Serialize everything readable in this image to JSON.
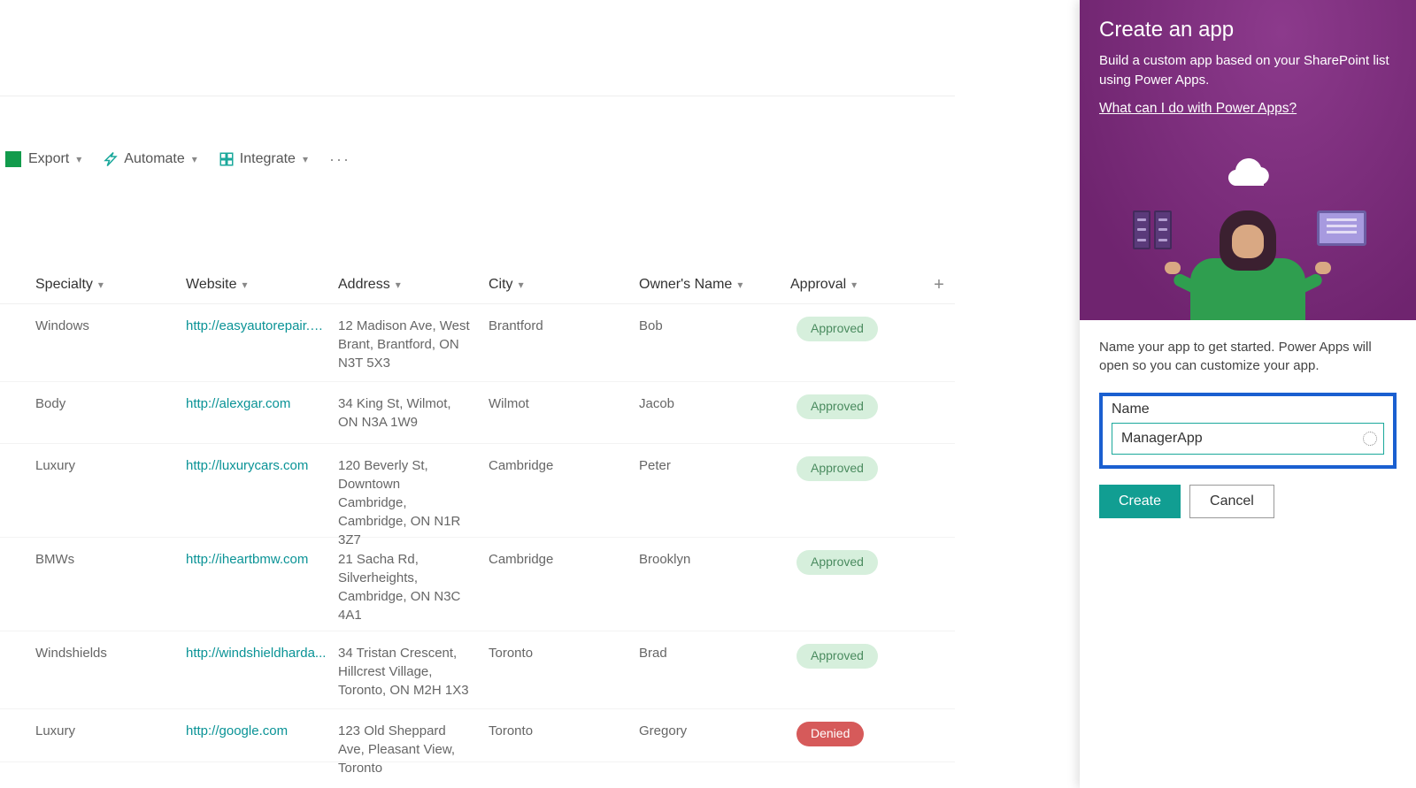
{
  "toolbar": {
    "export": "Export",
    "automate": "Automate",
    "integrate": "Integrate"
  },
  "columns": {
    "specialty": "Specialty",
    "website": "Website",
    "address": "Address",
    "city": "City",
    "owner": "Owner's Name",
    "approval": "Approval"
  },
  "rows": [
    {
      "specialty": "Windows",
      "website": "http://easyautorepair.c...",
      "address": "12 Madison Ave, West Brant, Brantford, ON N3T 5X3",
      "city": "Brantford",
      "owner": "Bob",
      "approval": "Approved"
    },
    {
      "specialty": "Body",
      "website": "http://alexgar.com",
      "address": "34 King St, Wilmot, ON N3A 1W9",
      "city": "Wilmot",
      "owner": "Jacob",
      "approval": "Approved"
    },
    {
      "specialty": "Luxury",
      "website": "http://luxurycars.com",
      "address": "120 Beverly St, Downtown Cambridge, Cambridge, ON N1R 3Z7",
      "city": "Cambridge",
      "owner": "Peter",
      "approval": "Approved"
    },
    {
      "specialty": "BMWs",
      "website": "http://iheartbmw.com",
      "address": "21 Sacha Rd, Silverheights, Cambridge, ON N3C 4A1",
      "city": "Cambridge",
      "owner": "Brooklyn",
      "approval": "Approved"
    },
    {
      "specialty": "Windshields",
      "website": "http://windshieldharda...",
      "address": "34 Tristan Crescent, Hillcrest Village, Toronto, ON M2H 1X3",
      "city": "Toronto",
      "owner": "Brad",
      "approval": "Approved"
    },
    {
      "specialty": "Luxury",
      "website": "http://google.com",
      "address": "123 Old Sheppard Ave, Pleasant View, Toronto",
      "city": "Toronto",
      "owner": "Gregory",
      "approval": "Denied"
    }
  ],
  "panel": {
    "title": "Create an app",
    "desc": "Build a custom app based on your SharePoint list using Power Apps.",
    "link": "What can I do with Power Apps?",
    "helper": "Name your app to get started. Power Apps will open so you can customize your app.",
    "field_label": "Name",
    "field_value": "ManagerApp",
    "create": "Create",
    "cancel": "Cancel"
  }
}
